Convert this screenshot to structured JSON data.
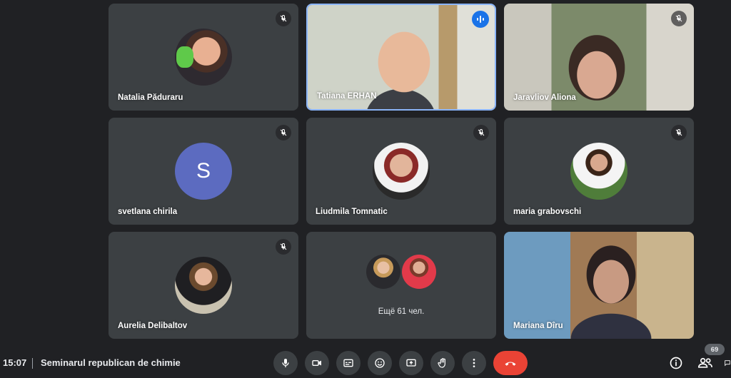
{
  "participants": [
    {
      "name": "Natalia Păduraru",
      "muted": true
    },
    {
      "name": "Tatiana ERHAN",
      "speaking": true
    },
    {
      "name": "Jaravliov Aliona",
      "muted": true
    },
    {
      "name": "svetlana chirila",
      "avatar_letter": "S",
      "avatar_color": "#5c6bc0",
      "muted": true
    },
    {
      "name": "Liudmila Tomnatic",
      "muted": true
    },
    {
      "name": "maria grabovschi",
      "muted": true
    },
    {
      "name": "Aurelia Delibaltov",
      "muted": true
    },
    {
      "name": "Mariana Dîru"
    }
  ],
  "others": {
    "label": "Ещё 61 чел."
  },
  "bottom_bar": {
    "time": "15:07",
    "meeting_title": "Seminarul republican de chimie",
    "participant_count": "69"
  },
  "controls": [
    "microphone",
    "camera",
    "captions",
    "emoji",
    "present-screen",
    "raise-hand",
    "more-options",
    "leave-call"
  ],
  "right_controls": [
    "meeting-info",
    "people",
    "chat"
  ],
  "colors": {
    "background": "#202124",
    "tile": "#3c4043",
    "active_border": "#8ab4f8",
    "speaking": "#1a73e8",
    "leave": "#ea4335"
  }
}
